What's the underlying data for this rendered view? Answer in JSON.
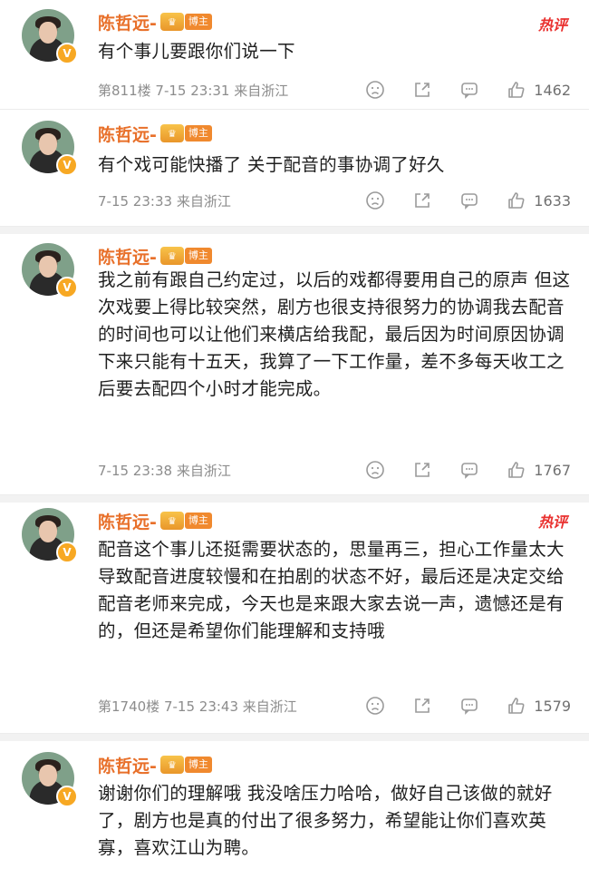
{
  "comments": [
    {
      "user": "陈哲远-",
      "badge_tag": "博主",
      "hot_label": "热评",
      "text": "有个事儿要跟你们说一下",
      "floor": "第811楼",
      "time": "7-15 23:31",
      "location": "来自浙江",
      "likes": "1462"
    },
    {
      "user": "陈哲远-",
      "badge_tag": "博主",
      "hot_label": "",
      "text": "有个戏可能快播了 关于配音的事协调了好久",
      "floor": "",
      "time": "7-15 23:33",
      "location": "来自浙江",
      "likes": "1633"
    },
    {
      "user": "陈哲远-",
      "badge_tag": "博主",
      "hot_label": "",
      "text": "我之前有跟自己约定过，以后的戏都得要用自己的原声 但这次戏要上得比较突然，剧方也很支持很努力的协调我去配音的时间也可以让他们来横店给我配，最后因为时间原因协调下来只能有十五天，我算了一下工作量，差不多每天收工之后要去配四个小时才能完成。",
      "floor": "",
      "time": "7-15 23:38",
      "location": "来自浙江",
      "likes": "1767"
    },
    {
      "user": "陈哲远-",
      "badge_tag": "博主",
      "hot_label": "热评",
      "text": "配音这个事儿还挺需要状态的，思量再三，担心工作量太大导致配音进度较慢和在拍剧的状态不好，最后还是决定交给配音老师来完成，今天也是来跟大家去说一声，遗憾还是有的，但还是希望你们能理解和支持哦",
      "floor": "第1740楼",
      "time": "7-15 23:43",
      "location": "来自浙江",
      "likes": "1579"
    },
    {
      "user": "陈哲远-",
      "badge_tag": "博主",
      "hot_label": "",
      "text": "谢谢你们的理解哦 我没啥压力哈哈，做好自己该做的就好了，剧方也是真的付出了很多努力，希望能让你们喜欢英寡，喜欢江山为聘。",
      "floor": "",
      "time": "",
      "location": "",
      "likes": ""
    }
  ],
  "icons": {
    "avatar_badge": "verified-v-icon",
    "dislike": "sad-face-icon",
    "share": "share-icon",
    "reply": "comment-bubble-icon",
    "like": "thumbs-up-icon"
  },
  "colors": {
    "username": "#e8702a",
    "hot": "#e9302e",
    "meta": "#8c8c8c"
  }
}
